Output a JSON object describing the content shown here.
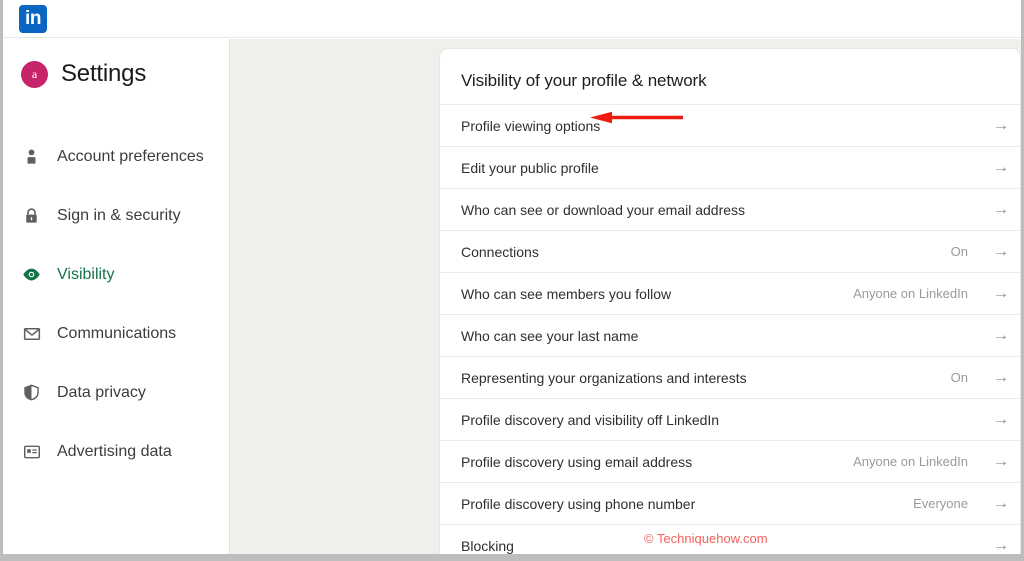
{
  "brand": {
    "logo_text": "in",
    "logo_color": "#0a66c2",
    "accent_green": "#15734b",
    "avatar_color": "#c8246c",
    "annotation_color": "#ee1b11",
    "watermark_color": "#f4615c"
  },
  "sidebar": {
    "avatar_initial": "a",
    "title": "Settings",
    "items": [
      {
        "label": "Account preferences",
        "icon": "person-icon",
        "active": false
      },
      {
        "label": "Sign in & security",
        "icon": "lock-icon",
        "active": false
      },
      {
        "label": "Visibility",
        "icon": "eye-icon",
        "active": true
      },
      {
        "label": "Communications",
        "icon": "envelope-icon",
        "active": false
      },
      {
        "label": "Data privacy",
        "icon": "shield-icon",
        "active": false
      },
      {
        "label": "Advertising data",
        "icon": "id-card-icon",
        "active": false
      }
    ]
  },
  "main": {
    "title": "Visibility of your profile & network",
    "rows": [
      {
        "label": "Profile viewing options",
        "value": "",
        "arrow": "→"
      },
      {
        "label": "Edit your public profile",
        "value": "",
        "arrow": "→"
      },
      {
        "label": "Who can see or download your email address",
        "value": "",
        "arrow": "→"
      },
      {
        "label": "Connections",
        "value": "On",
        "arrow": "→"
      },
      {
        "label": "Who can see members you follow",
        "value": "Anyone on LinkedIn",
        "arrow": "→"
      },
      {
        "label": "Who can see your last name",
        "value": "",
        "arrow": "→"
      },
      {
        "label": "Representing your organizations and interests",
        "value": "On",
        "arrow": "→"
      },
      {
        "label": "Profile discovery and visibility off LinkedIn",
        "value": "",
        "arrow": "→"
      },
      {
        "label": "Profile discovery using email address",
        "value": "Anyone on LinkedIn",
        "arrow": "→"
      },
      {
        "label": "Profile discovery using phone number",
        "value": "Everyone",
        "arrow": "→"
      },
      {
        "label": "Blocking",
        "value": "",
        "arrow": "→"
      }
    ]
  },
  "annotation": {
    "target_row": "Profile viewing options",
    "direction": "left"
  },
  "watermark": {
    "text": "© Techniquehow.com"
  }
}
